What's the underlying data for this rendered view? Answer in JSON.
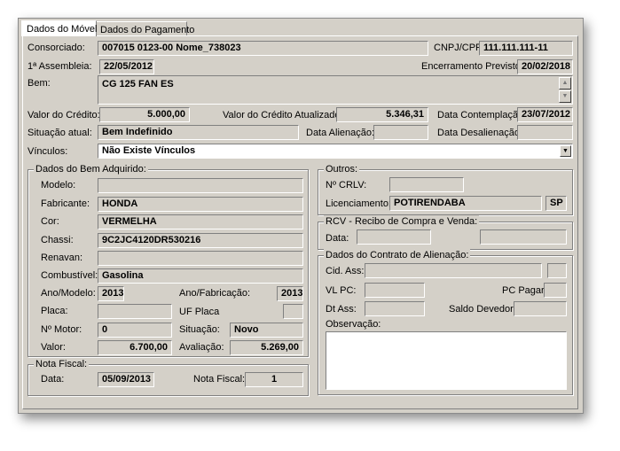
{
  "tabs": [
    "Dados do Móvel",
    "Dados do Pagamento"
  ],
  "top": {
    "consorciado_label": "Consorciado:",
    "consorciado_value": "007015 0123-00  Nome_738023",
    "cnpj_label": "CNPJ/CPF:",
    "cnpj_value": "111.111.111-11",
    "assembleia_label": "1ª  Assembleia:",
    "assembleia_value": "22/05/2012",
    "encerramento_label": "Encerramento Previsto:",
    "encerramento_value": "20/02/2018",
    "bem_label": "Bem:",
    "bem_value": "CG 125 FAN ES",
    "valor_credito_label": "Valor do Crédito:",
    "valor_credito_value": "5.000,00",
    "valor_atualizado_label": "Valor do Crédito Atualizado:",
    "valor_atualizado_value": "5.346,31",
    "data_contemplacao_label": "Data Contemplação:",
    "data_contemplacao_value": "23/07/2012",
    "situacao_label": "Situação atual:",
    "situacao_value": "Bem Indefinido",
    "data_alienacao_label": "Data Alienação:",
    "data_alienacao_value": "",
    "data_desalienacao_label": "Data Desalienação:",
    "data_desalienacao_value": "",
    "vinculos_label": "Vínculos:",
    "vinculos_value": "Não Existe Vínculos"
  },
  "bem_adquirido": {
    "title": "Dados do Bem Adquirido:",
    "modelo_label": "Modelo:",
    "modelo_value": "",
    "fabricante_label": "Fabricante:",
    "fabricante_value": "HONDA",
    "cor_label": "Cor:",
    "cor_value": "VERMELHA",
    "chassi_label": "Chassi:",
    "chassi_value": "9C2JC4120DR530216",
    "renavan_label": "Renavan:",
    "renavan_value": "",
    "combustivel_label": "Combustível:",
    "combustivel_value": "Gasolina",
    "ano_modelo_label": "Ano/Modelo:",
    "ano_modelo_value": "2013",
    "ano_fabricacao_label": "Ano/Fabricação:",
    "ano_fabricacao_value": "2013",
    "placa_label": "Placa:",
    "placa_value": "",
    "uf_placa_label": "UF Placa",
    "uf_placa_value": "",
    "motor_label": "Nº Motor:",
    "motor_value": "0",
    "situacao_label": "Situação:",
    "situacao_value": "Novo",
    "valor_label": "Valor:",
    "valor_value": "6.700,00",
    "avaliacao_label": "Avaliação:",
    "avaliacao_value": "5.269,00"
  },
  "nota_fiscal": {
    "title": "Nota Fiscal:",
    "data_label": "Data:",
    "data_value": "05/09/2013",
    "numero_label": "Nota Fiscal:",
    "numero_value": "1"
  },
  "outros": {
    "title": "Outros:",
    "crlv_label": "Nº  CRLV:",
    "crlv_value": "",
    "licenciamento_label": "Licenciamento:",
    "licenciamento_value": "POTIRENDABA",
    "licenciamento_uf": "SP"
  },
  "rcv": {
    "title": "RCV - Recibo de Compra e Venda:",
    "data_label": "Data:",
    "data_value": "",
    "extra_value": ""
  },
  "contrato": {
    "title": "Dados do Contrato de Alienação:",
    "cid_label": "Cid. Ass:",
    "cid_value": "",
    "cid_uf": "",
    "vlpc_label": "VL PC:",
    "vlpc_value": "",
    "pc_pagar_label": "PC Pagar:",
    "pc_pagar_value": "",
    "dtass_label": "Dt Ass:",
    "dtass_value": "",
    "saldo_label": "Saldo Devedor:",
    "saldo_value": "",
    "obs_label": "Observação:",
    "obs_value": ""
  }
}
